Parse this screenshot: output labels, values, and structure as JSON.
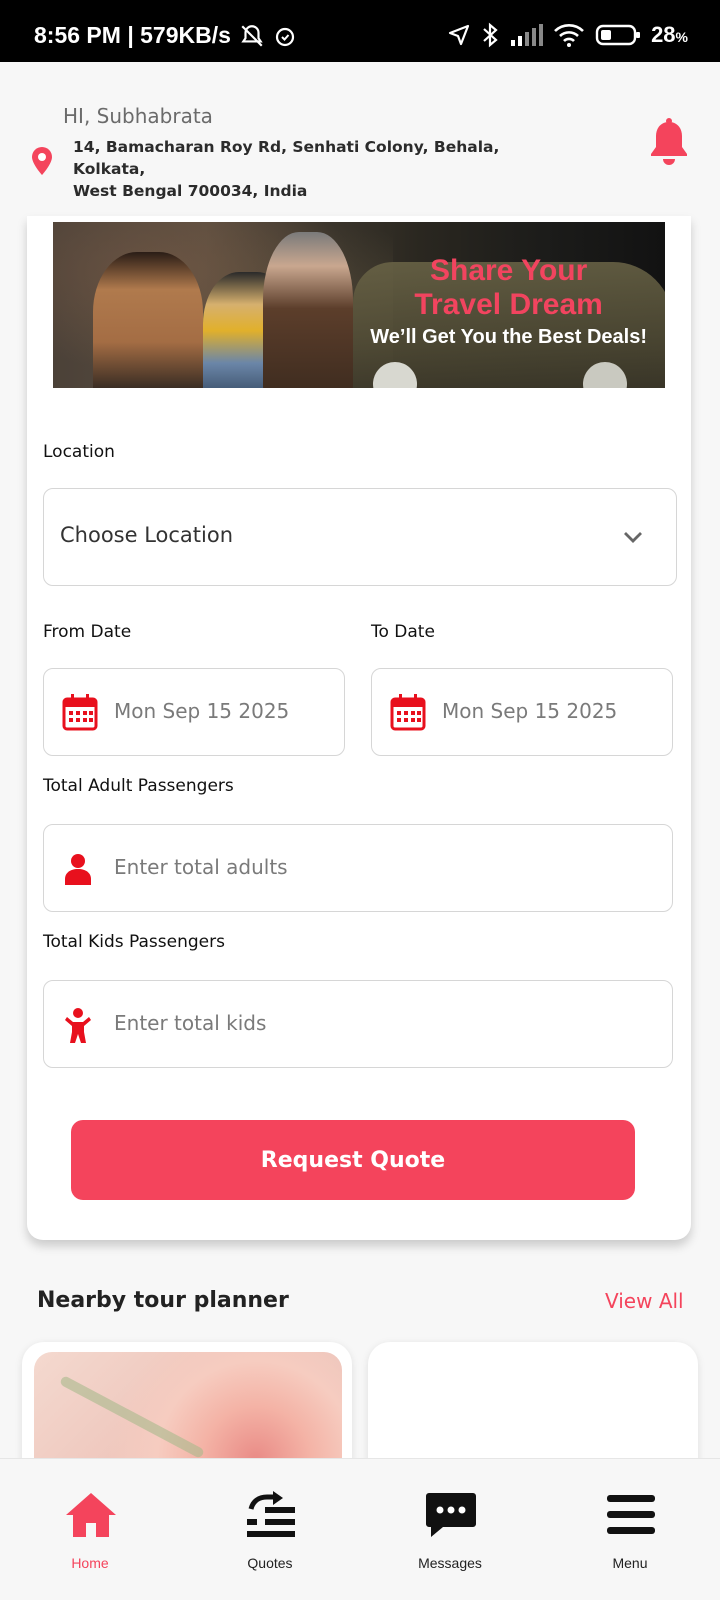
{
  "status_bar": {
    "time_speed": "8:56 PM | 579KB/s",
    "battery": "28",
    "battery_unit": "%"
  },
  "header": {
    "greeting": "HI, Subhabrata",
    "address_line1": "14, Bamacharan Roy Rd, Senhati Colony, Behala, Kolkata,",
    "address_line2": "West Bengal 700034, India"
  },
  "banner": {
    "line1": "Share Your",
    "line2": "Travel Dream",
    "line3": "We’ll Get You the Best Deals!"
  },
  "form": {
    "location_label": "Location",
    "location_placeholder": "Choose Location",
    "from_date_label": "From Date",
    "from_date_value": "Mon Sep 15 2025",
    "to_date_label": "To Date",
    "to_date_value": "Mon Sep 15 2025",
    "adults_label": "Total Adult Passengers",
    "adults_placeholder": "Enter total adults",
    "kids_label": "Total Kids Passengers",
    "kids_placeholder": "Enter total kids",
    "submit_label": "Request Quote"
  },
  "nearby": {
    "title": "Nearby tour planner",
    "view_all": "View All"
  },
  "nav": {
    "items": [
      {
        "label": "Home",
        "icon": "home-icon",
        "active": true
      },
      {
        "label": "Quotes",
        "icon": "quotes-icon",
        "active": false
      },
      {
        "label": "Messages",
        "icon": "messages-icon",
        "active": false
      },
      {
        "label": "Menu",
        "icon": "menu-icon",
        "active": false
      }
    ]
  },
  "colors": {
    "accent": "#f4445c",
    "icon_red": "#e8101d"
  }
}
